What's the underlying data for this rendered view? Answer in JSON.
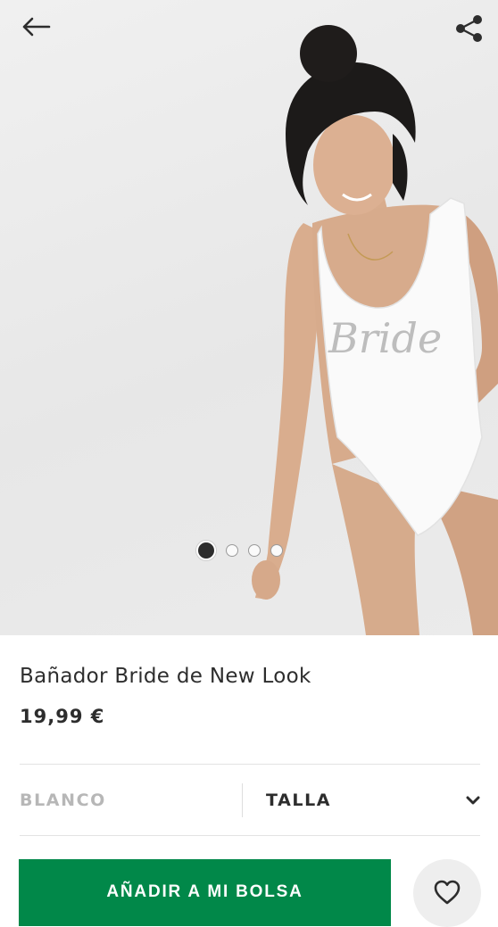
{
  "header": {
    "back_icon": "arrow-left-icon",
    "share_icon": "share-icon"
  },
  "gallery": {
    "image_text": "Bride",
    "slide_count": 4,
    "active_slide": 1
  },
  "product": {
    "name": "Bañador Bride de New Look",
    "price": "19,99 €"
  },
  "options": {
    "colour": "BLANCO",
    "size_label": "TALLA",
    "size_icon": "chevron-down-icon"
  },
  "actions": {
    "add_to_bag": "AÑADIR A MI BOLSA",
    "wishlist_icon": "heart-icon"
  },
  "colors": {
    "primary_button": "#018849",
    "text": "#2d2d2d",
    "muted_text": "#b7b7b7"
  }
}
